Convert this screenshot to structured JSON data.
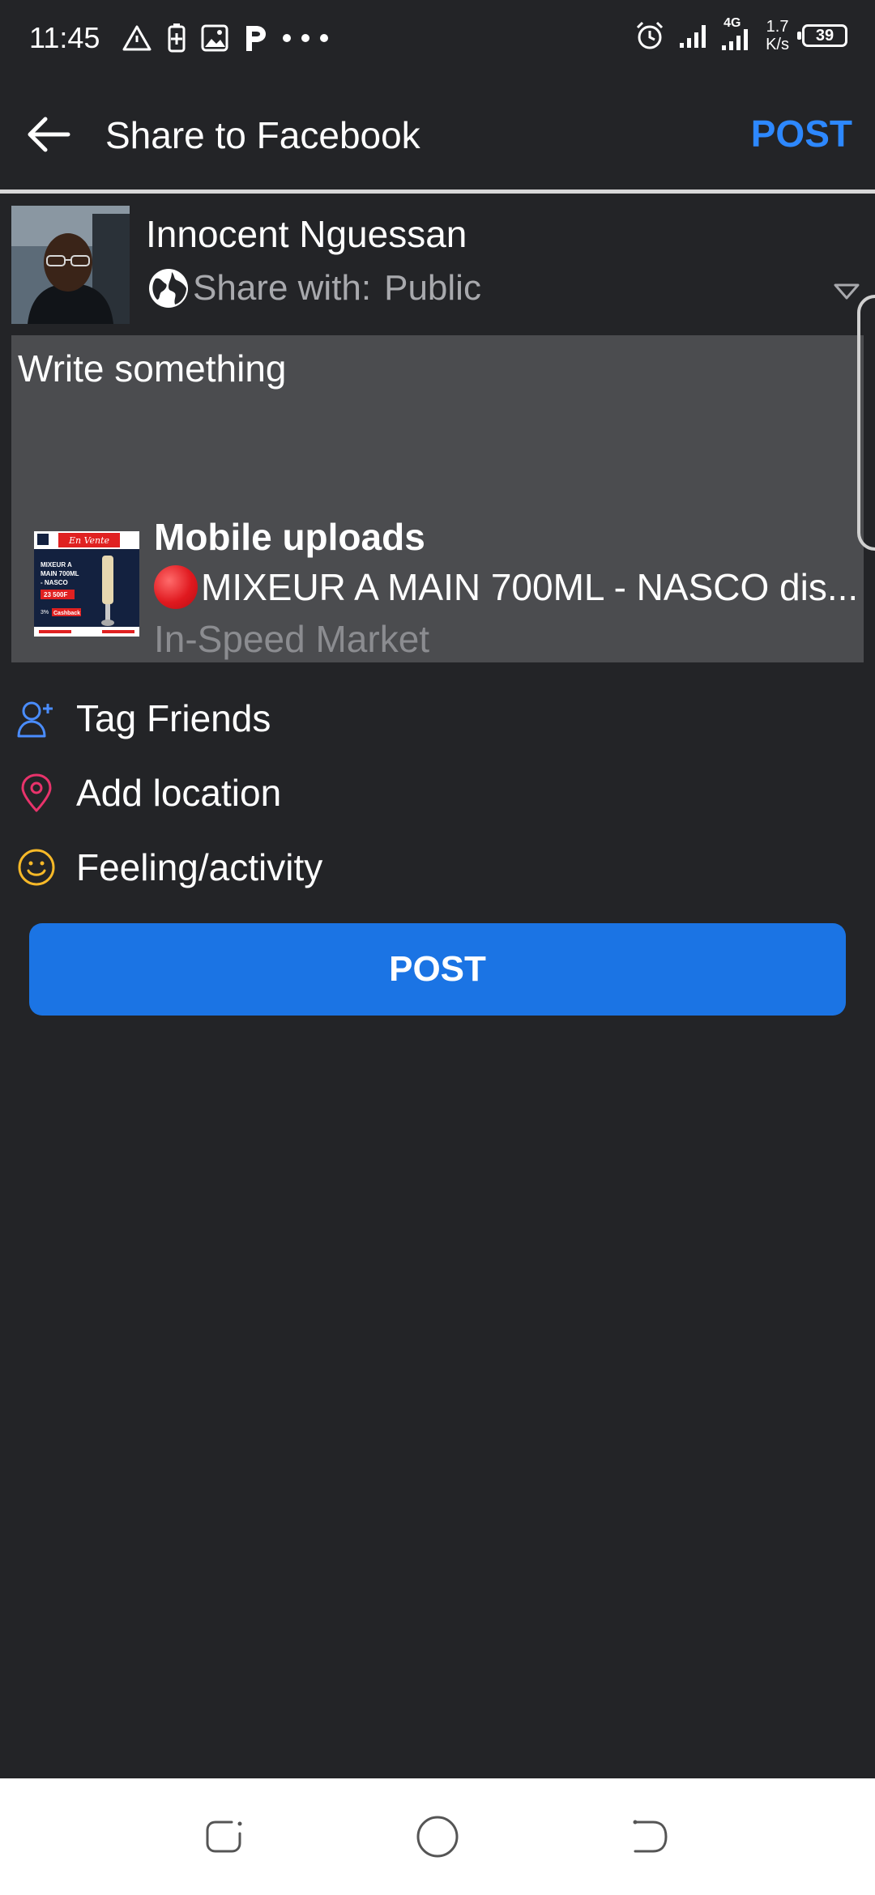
{
  "status_bar": {
    "time": "11:45",
    "net_speed_value": "1.7",
    "net_speed_unit": "K/s",
    "network_type": "4G",
    "battery_level": "39",
    "left_icons": [
      "alert-triangle-icon",
      "battery-saver-icon",
      "image-icon",
      "p-app-icon",
      "more-dots-icon"
    ],
    "right_icons": [
      "alarm-icon",
      "signal-icon",
      "signal-4g-icon"
    ]
  },
  "header": {
    "back_icon": "arrow-left-icon",
    "title": "Share to Facebook",
    "post_label": "POST",
    "accent_color": "#2d88ff"
  },
  "composer": {
    "user_name": "Innocent Nguessan",
    "share_label": "Share with:",
    "audience": "Public",
    "audience_icon": "globe-icon",
    "input_placeholder": "Write something"
  },
  "link_preview": {
    "title": "Mobile uploads",
    "subtitle": "MIXEUR A MAIN 700ML - NASCO dis...",
    "source": "In-Speed Market",
    "thumbnail_text": {
      "badge": "En Vente",
      "line1": "MIXEUR A",
      "line2": "MAIN 700ML",
      "line3": "- NASCO",
      "price": "23 500F",
      "cashback": "Cashback",
      "cashback_pct": "3%"
    }
  },
  "actions": [
    {
      "label": "Tag Friends",
      "icon": "tag-person-icon",
      "color": "#4a8dff"
    },
    {
      "label": "Add location",
      "icon": "location-pin-icon",
      "color": "#e8336b"
    },
    {
      "label": "Feeling/activity",
      "icon": "smiley-icon",
      "color": "#f7b928"
    }
  ],
  "post_button": {
    "label": "POST",
    "color": "#1b74e4"
  },
  "nav_bar": {
    "items": [
      "recent-apps-icon",
      "home-icon",
      "back-icon"
    ]
  }
}
